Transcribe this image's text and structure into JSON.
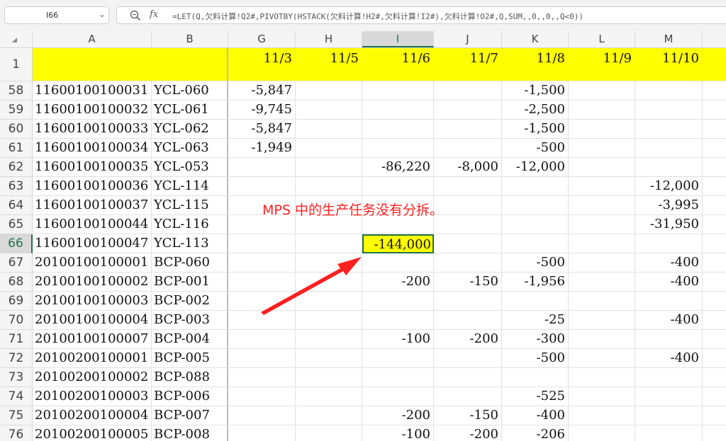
{
  "formula_bar": {
    "name_box": "I66",
    "fx_label": "fx",
    "formula": "=LET(Q,欠料计算!Q2#,PIVOTBY(HSTACK(欠料计算!H2#,欠料计算!I2#),欠料计算!O2#,Q,SUM,,0,,0,,Q<0))"
  },
  "columns": [
    "A",
    "B",
    "G",
    "H",
    "I",
    "J",
    "K",
    "L",
    "M"
  ],
  "selected_column": "I",
  "header_row": {
    "row_number": "1",
    "dates": [
      "11/3",
      "11/5",
      "11/6",
      "11/7",
      "11/8",
      "11/9",
      "11/10"
    ]
  },
  "rows": [
    {
      "n": "58",
      "a": "11600100100031",
      "b": "YCL-060",
      "g": "-5,847",
      "h": "",
      "i": "",
      "j": "",
      "k": "-1,500",
      "l": "",
      "m": ""
    },
    {
      "n": "59",
      "a": "11600100100032",
      "b": "YCL-061",
      "g": "-9,745",
      "h": "",
      "i": "",
      "j": "",
      "k": "-2,500",
      "l": "",
      "m": ""
    },
    {
      "n": "60",
      "a": "11600100100033",
      "b": "YCL-062",
      "g": "-5,847",
      "h": "",
      "i": "",
      "j": "",
      "k": "-1,500",
      "l": "",
      "m": ""
    },
    {
      "n": "61",
      "a": "11600100100034",
      "b": "YCL-063",
      "g": "-1,949",
      "h": "",
      "i": "",
      "j": "",
      "k": "-500",
      "l": "",
      "m": ""
    },
    {
      "n": "62",
      "a": "11600100100035",
      "b": "YCL-053",
      "g": "",
      "h": "",
      "i": "-86,220",
      "j": "-8,000",
      "k": "-12,000",
      "l": "",
      "m": ""
    },
    {
      "n": "63",
      "a": "11600100100036",
      "b": "YCL-114",
      "g": "",
      "h": "",
      "i": "",
      "j": "",
      "k": "",
      "l": "",
      "m": "-12,000"
    },
    {
      "n": "64",
      "a": "11600100100037",
      "b": "YCL-115",
      "g": "",
      "h": "",
      "i": "",
      "j": "",
      "k": "",
      "l": "",
      "m": "-3,995"
    },
    {
      "n": "65",
      "a": "11600100100044",
      "b": "YCL-116",
      "g": "",
      "h": "",
      "i": "",
      "j": "",
      "k": "",
      "l": "",
      "m": "-31,950"
    },
    {
      "n": "66",
      "a": "11600100100047",
      "b": "YCL-113",
      "g": "",
      "h": "",
      "i": "-144,000",
      "j": "",
      "k": "",
      "l": "",
      "m": ""
    },
    {
      "n": "67",
      "a": "20100100100001",
      "b": "BCP-060",
      "g": "",
      "h": "",
      "i": "",
      "j": "",
      "k": "-500",
      "l": "",
      "m": "-400"
    },
    {
      "n": "68",
      "a": "20100100100002",
      "b": "BCP-001",
      "g": "",
      "h": "",
      "i": "-200",
      "j": "-150",
      "k": "-1,956",
      "l": "",
      "m": "-400"
    },
    {
      "n": "69",
      "a": "20100100100003",
      "b": "BCP-002",
      "g": "",
      "h": "",
      "i": "",
      "j": "",
      "k": "",
      "l": "",
      "m": ""
    },
    {
      "n": "70",
      "a": "20100100100004",
      "b": "BCP-003",
      "g": "",
      "h": "",
      "i": "",
      "j": "",
      "k": "-25",
      "l": "",
      "m": "-400"
    },
    {
      "n": "71",
      "a": "20100100100007",
      "b": "BCP-004",
      "g": "",
      "h": "",
      "i": "-100",
      "j": "-200",
      "k": "-300",
      "l": "",
      "m": ""
    },
    {
      "n": "72",
      "a": "20100200100001",
      "b": "BCP-005",
      "g": "",
      "h": "",
      "i": "",
      "j": "",
      "k": "-500",
      "l": "",
      "m": "-400"
    },
    {
      "n": "73",
      "a": "20100200100002",
      "b": "BCP-088",
      "g": "",
      "h": "",
      "i": "",
      "j": "",
      "k": "",
      "l": "",
      "m": ""
    },
    {
      "n": "74",
      "a": "20100200100003",
      "b": "BCP-006",
      "g": "",
      "h": "",
      "i": "",
      "j": "",
      "k": "-525",
      "l": "",
      "m": ""
    },
    {
      "n": "75",
      "a": "20100200100004",
      "b": "BCP-007",
      "g": "",
      "h": "",
      "i": "-200",
      "j": "-150",
      "k": "-400",
      "l": "",
      "m": ""
    },
    {
      "n": "76",
      "a": "20100200100005",
      "b": "BCP-008",
      "g": "",
      "h": "",
      "i": "-100",
      "j": "-200",
      "k": "-206",
      "l": "",
      "m": ""
    }
  ],
  "active_cell": {
    "row": "66",
    "col": "i"
  },
  "annotation": "MPS 中的生产任务没有分拆。",
  "colors": {
    "header_fill": "#ffff00",
    "annotation": "#ff2020",
    "selection": "#217346"
  }
}
